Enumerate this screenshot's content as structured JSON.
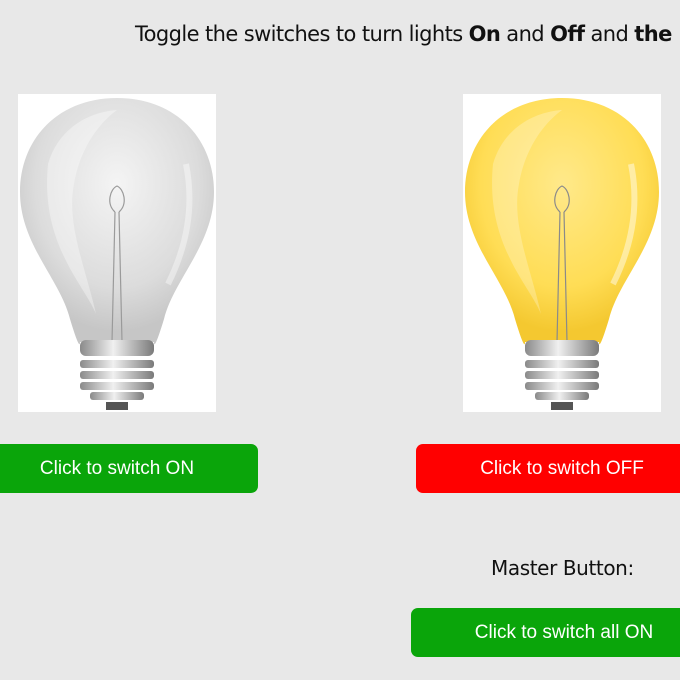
{
  "instructions": {
    "prefix": "Toggle the switches to turn lights ",
    "on_word": "On",
    "middle": " and ",
    "off_word": "Off",
    "middle2": " and ",
    "tail_bold": "the m"
  },
  "bulbs": [
    {
      "state": "off",
      "glass_color": "#d9d9d9",
      "button_label": "Click to switch ON",
      "button_color": "#0aa50a"
    },
    {
      "state": "on",
      "glass_color": "#ffdb4d",
      "button_label": "Click to switch OFF",
      "button_color": "#ff0000"
    }
  ],
  "master": {
    "label": "Master Button:",
    "button_label": "Click to switch all ON",
    "button_color": "#0aa50a"
  }
}
